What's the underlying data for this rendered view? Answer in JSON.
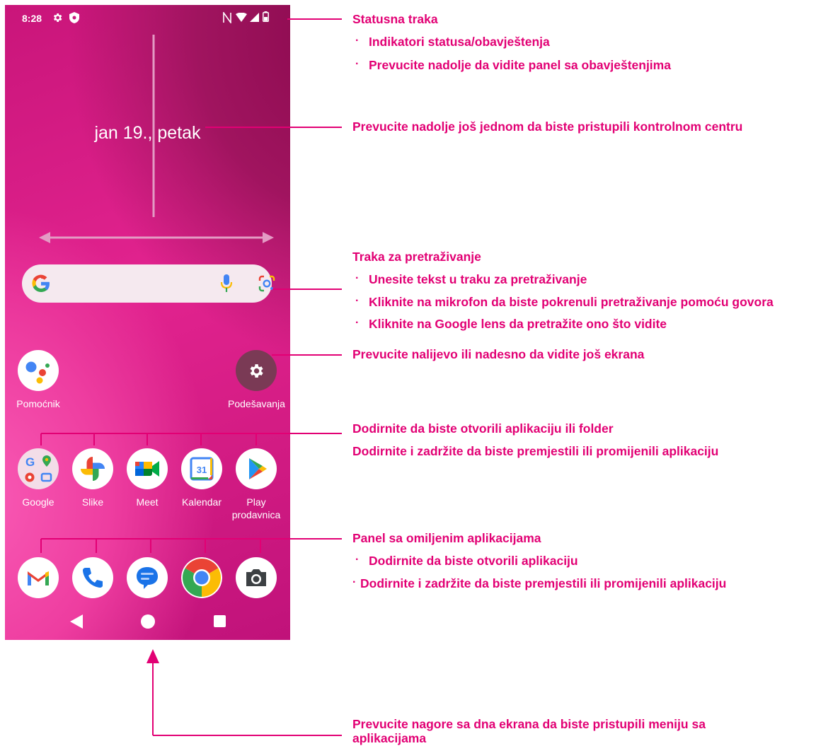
{
  "phone": {
    "status": {
      "time": "8:28"
    },
    "date": "jan 19., petak",
    "apps_row1": [
      {
        "label": "Pomoćnik"
      },
      {
        "label": "Podešavanja"
      }
    ],
    "apps_row2": [
      {
        "label": "Google"
      },
      {
        "label": "Slike"
      },
      {
        "label": "Meet"
      },
      {
        "label": "Kalendar",
        "day": "31"
      },
      {
        "label": "Play prodavnica"
      }
    ],
    "dock": [
      {
        "name": "gmail"
      },
      {
        "name": "phone"
      },
      {
        "name": "messages"
      },
      {
        "name": "chrome"
      },
      {
        "name": "camera"
      }
    ]
  },
  "annotations": {
    "status_title": "Statusna traka",
    "status_b1": "Indikatori statusa/obavještenja",
    "status_b2": "Prevucite nadolje da vidite panel sa obavještenjima",
    "control": "Prevucite nadolje još jednom da biste pristupili kontrolnom centru",
    "search_title": "Traka za pretraživanje",
    "search_b1": "Unesite tekst u traku za pretraživanje",
    "search_b2": "Kliknite na mikrofon da biste pokrenuli pretraživanje pomoću govora",
    "search_b3": "Kliknite na Google lens da pretražite ono što vidite",
    "swipe": "Prevucite nalijevo ili nadesno da vidite još ekrana",
    "tap1": "Dodirnite da biste otvorili aplikaciju ili folder",
    "tap2": "Dodirnite i zadržite da biste premjestili ili promijenili aplikaciju",
    "fav_title": "Panel sa omiljenim aplikacijama",
    "fav_b1": "Dodirnite da biste otvorili aplikaciju",
    "fav_b2": "Dodirnite i zadržite da biste premjestili ili promijenili aplikaciju",
    "bottom_line1": "Prevucite nagore sa dna ekrana da biste pristupili meniju sa",
    "bottom_line2": "aplikacijama"
  },
  "colors": {
    "accent": "#e20074",
    "phone_bg": "#d41c84"
  }
}
